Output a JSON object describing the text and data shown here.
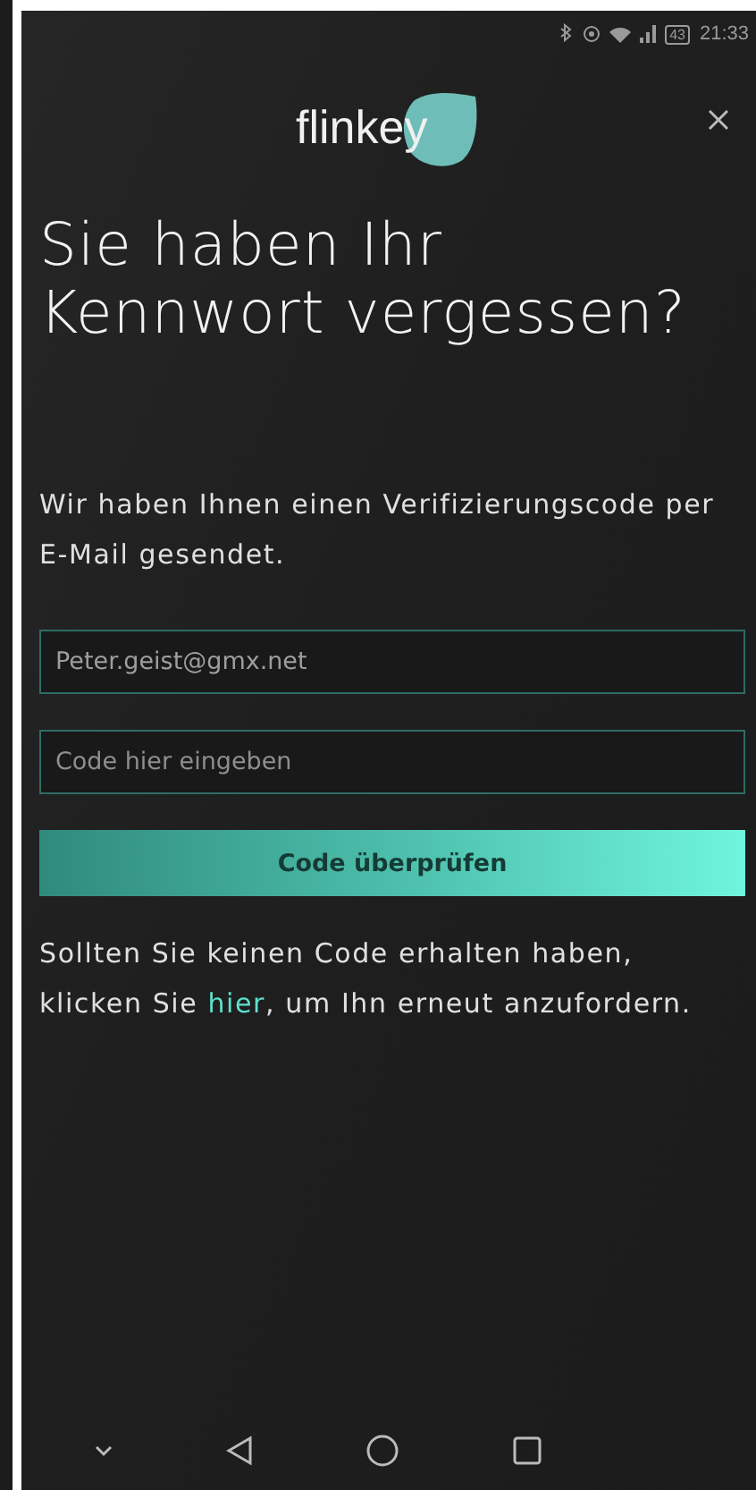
{
  "status_bar": {
    "battery": "43",
    "time": "21:33"
  },
  "logo": {
    "text": "flinkey"
  },
  "title_lines": [
    "Sie haben Ihr",
    "Kennwort vergessen?"
  ],
  "message": "Wir haben Ihnen einen Verifizierungscode per E-Mail gesendet.",
  "email_field": {
    "value": "Peter.geist@gmx.net"
  },
  "code_field": {
    "placeholder": "Code hier eingeben"
  },
  "verify_button": "Code überprüfen",
  "resend_text": {
    "before": "Sollten Sie keinen Code erhalten haben, klicken Sie",
    "link": "hier",
    "after": ", um Ihn erneut anzufordern."
  }
}
